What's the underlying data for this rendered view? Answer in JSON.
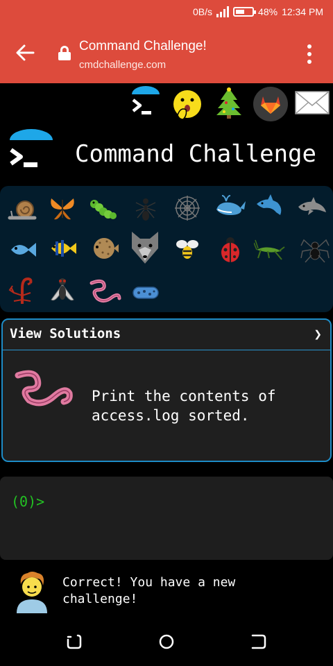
{
  "status_bar": {
    "net_speed": "0B/s",
    "battery_percent": "48%",
    "battery_level": 0.48,
    "time": "12:34 PM"
  },
  "browser": {
    "page_title": "Command Challenge!",
    "url": "cmdchallenge.com"
  },
  "top_icons": [
    "terminal-logo-icon",
    "zipper-face-icon",
    "christmas-tree-icon",
    "gitlab-icon",
    "envelope-icon"
  ],
  "header": {
    "title": "Command Challenge"
  },
  "animals": [
    "snail",
    "butterfly",
    "caterpillar",
    "ant",
    "spider-web",
    "whale",
    "dolphin",
    "dolphin-gray",
    "fish",
    "tropical-fish",
    "blowfish",
    "wolf",
    "bee",
    "ladybug",
    "cricket",
    "spider",
    "scorpion",
    "fly",
    "worm",
    "microbe"
  ],
  "card": {
    "title": "View Solutions",
    "chevron": "❯",
    "icon": "worm-icon",
    "challenge_text": "Print the contents of\naccess.log sorted."
  },
  "terminal": {
    "prompt": "(0)>"
  },
  "message": {
    "text": "Correct! You have a new\nchallenge!",
    "icon": "person-icon"
  },
  "colors": {
    "brand_red": "#dd4b3c",
    "card_border": "#1d8cc7",
    "prompt_green": "#23c223",
    "logo_blue": "#1ea7e8"
  }
}
